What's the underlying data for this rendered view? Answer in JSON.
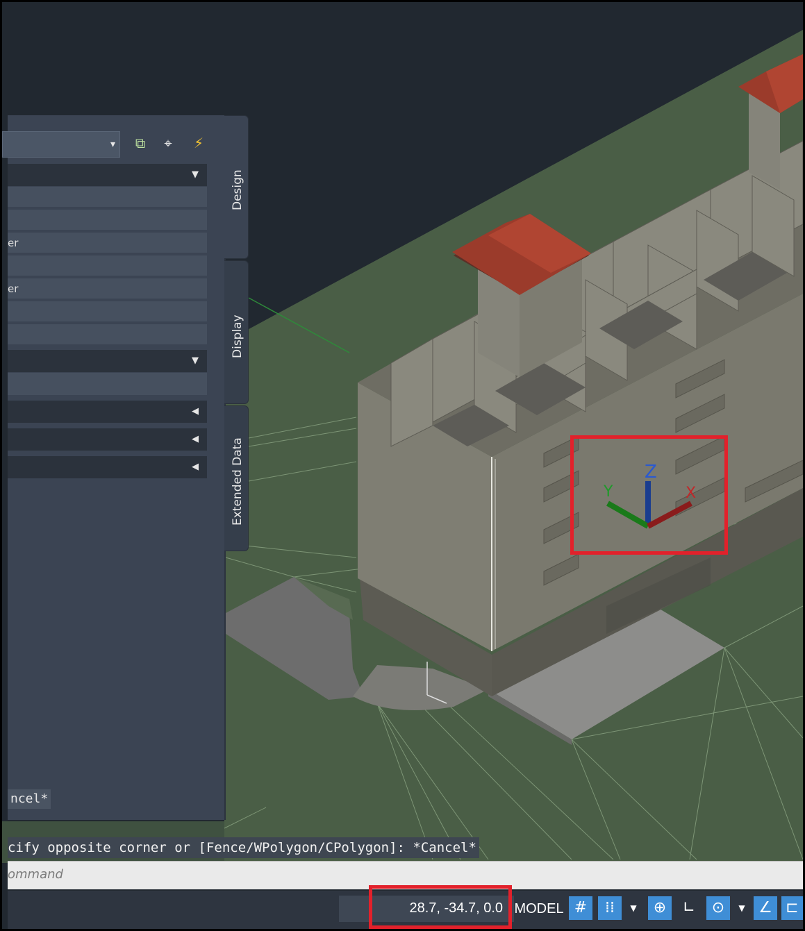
{
  "palette": {
    "tabs": [
      "Design",
      "Display",
      "Extended Data"
    ],
    "row_labels": {
      "r3": "er",
      "r5": "er"
    },
    "cancel_chip": "ncel*"
  },
  "viewport": {
    "ucs_axes": {
      "x": "X",
      "y": "Y",
      "z": "Z"
    }
  },
  "command": {
    "history": "cify opposite corner or [Fence/WPolygon/CPolygon]: *Cancel*",
    "placeholder": "ommand"
  },
  "status": {
    "coordinates": "28.7, -34.7, 0.0",
    "model_label": "MODEL",
    "icons": [
      "grid-icon",
      "snap-icon",
      "dropdown-icon",
      "infer-constraints-icon",
      "ortho-icon",
      "polar-tracking-icon",
      "dropdown-icon",
      "isodraft-icon",
      "object-snap-tracking-icon"
    ]
  },
  "colors": {
    "background": "#212830",
    "ground": "#4a5e46",
    "building": "#7e7c70",
    "roof": "#9b3b2b",
    "palette": "#3b4453",
    "highlight": "#e2212b",
    "axis_x": "#8a1c1c",
    "axis_y": "#1a7a1a",
    "axis_z": "#1a3d8f"
  }
}
